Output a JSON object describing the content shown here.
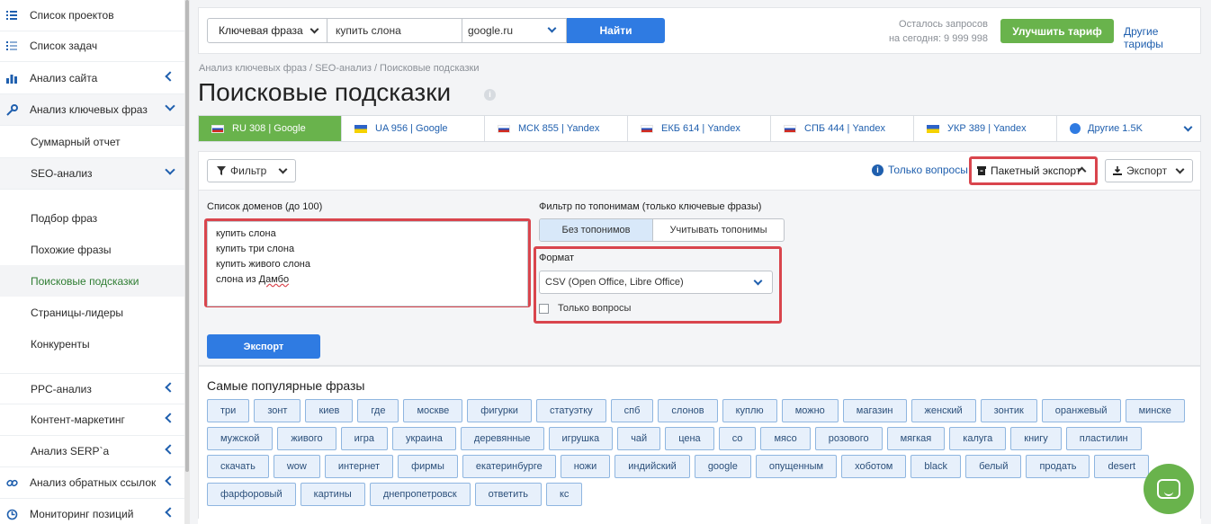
{
  "sidebar": {
    "items": [
      {
        "label": "Список проектов"
      },
      {
        "label": "Список задач"
      },
      {
        "label": "Анализ сайта"
      },
      {
        "label": "Анализ ключевых фраз"
      },
      {
        "label": "Суммарный отчет"
      },
      {
        "label": "SEO-анализ"
      },
      {
        "label": "Подбор фраз"
      },
      {
        "label": "Похожие фразы"
      },
      {
        "label": "Поисковые подсказки"
      },
      {
        "label": "Страницы-лидеры"
      },
      {
        "label": "Конкуренты"
      },
      {
        "label": "PPC-анализ"
      },
      {
        "label": "Контент-маркетинг"
      },
      {
        "label": "Анализ SERP`а"
      },
      {
        "label": "Анализ обратных ссылок"
      },
      {
        "label": "Мониторинг позиций"
      }
    ]
  },
  "search": {
    "type_label": "Ключевая фраза",
    "query": "купить слона",
    "engine": "google.ru",
    "submit_label": "Найти"
  },
  "quota": {
    "line1": "Осталось запросов",
    "line2": "на сегодня: 9 999 998"
  },
  "upgrade_label": "Улучшить тариф",
  "other_tariffs_label": "Другие тарифы",
  "breadcrumb": "Анализ ключевых фраз / SEO-анализ / Поисковые подсказки",
  "page_title": "Поисковые подсказки",
  "region_tabs": [
    {
      "label": "RU 308 | Google",
      "flag": "ru"
    },
    {
      "label": "UA 956 | Google",
      "flag": "ua"
    },
    {
      "label": "МСК 855 | Yandex",
      "flag": "ru"
    },
    {
      "label": "ЕКБ 614 | Yandex",
      "flag": "ru"
    },
    {
      "label": "СПБ 444 | Yandex",
      "flag": "ru"
    },
    {
      "label": "УКР 389 | Yandex",
      "flag": "ua"
    },
    {
      "label": "Другие 1.5K",
      "flag": "globe"
    }
  ],
  "toolbar": {
    "filter_label": "Фильтр",
    "only_questions_label": "Только вопросы",
    "bulk_export_label": "Пакетный экспорт",
    "export_label": "Экспорт"
  },
  "export_panel": {
    "domains_label": "Список доменов (до 100)",
    "domains": [
      "купить слона",
      "купить три слона",
      "купить живого слона",
      "слона из "
    ],
    "domains_last_underlined": "Дамбо",
    "toponym_label": "Фильтр по топонимам (только ключевые фразы)",
    "toponym_options": [
      "Без топонимов",
      "Учитывать топонимы"
    ],
    "format_label": "Формат",
    "format_value": "CSV (Open Office, Libre Office)",
    "only_questions_checkbox": "Только вопросы",
    "export_button": "Экспорт"
  },
  "popular": {
    "title": "Самые популярные фразы",
    "chips": [
      "три",
      "зонт",
      "киев",
      "где",
      "москве",
      "фигурки",
      "статуэтку",
      "спб",
      "слонов",
      "куплю",
      "можно",
      "магазин",
      "женский",
      "зонтик",
      "оранжевый",
      "минске",
      "мужской",
      "живого",
      "игра",
      "украина",
      "деревянные",
      "игрушка",
      "чай",
      "цена",
      "со",
      "мясо",
      "розового",
      "мягкая",
      "калуга",
      "книгу",
      "пластилин",
      "скачать",
      "wow",
      "интернет",
      "фирмы",
      "екатеринбурге",
      "ножи",
      "индийский",
      "google",
      "опущенным",
      "хоботом",
      "black",
      "белый",
      "продать",
      "desert",
      "фарфоровый",
      "картины",
      "днепропетровск",
      "ответить",
      "кс"
    ]
  }
}
